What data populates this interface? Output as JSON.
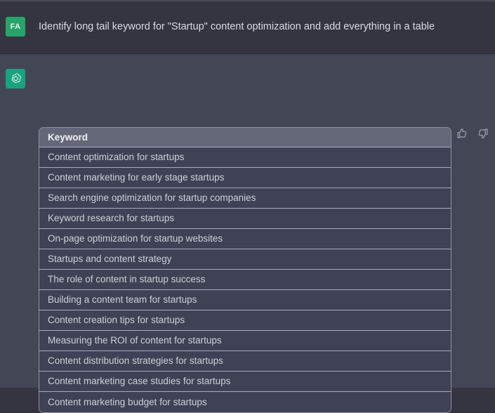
{
  "theme": {
    "page_bg": "#40414f",
    "user_bg": "#343541",
    "assistant_bg": "#434654",
    "accent_green": "#28a36a",
    "bot_green": "#19a37e",
    "table_border": "#a9abbb",
    "header_bg": "#636777",
    "row_bg": "#3f4254",
    "text_primary": "#d8dae2",
    "text_cell": "#ccd0da"
  },
  "user_message": {
    "avatar_initials": "FA",
    "avatar_name": "user-avatar",
    "text": "Identify long tail keyword for \"Startup\" content optimization and add everything in a table"
  },
  "assistant_message": {
    "avatar_icon": "openai-logo-icon",
    "table": {
      "columns": [
        "Keyword"
      ],
      "rows": [
        [
          "Content optimization for startups"
        ],
        [
          "Content marketing for early stage startups"
        ],
        [
          "Search engine optimization for startup companies"
        ],
        [
          "Keyword research for startups"
        ],
        [
          "On-page optimization for startup websites"
        ],
        [
          "Startups and content strategy"
        ],
        [
          "The role of content in startup success"
        ],
        [
          "Building a content team for startups"
        ],
        [
          "Content creation tips for startups"
        ],
        [
          "Measuring the ROI of content for startups"
        ],
        [
          "Content distribution strategies for startups"
        ],
        [
          "Content marketing case studies for startups"
        ],
        [
          "Content marketing budget for startups"
        ]
      ]
    },
    "feedback": {
      "thumbs_up_icon": "thumbs-up-icon",
      "thumbs_down_icon": "thumbs-down-icon"
    }
  }
}
